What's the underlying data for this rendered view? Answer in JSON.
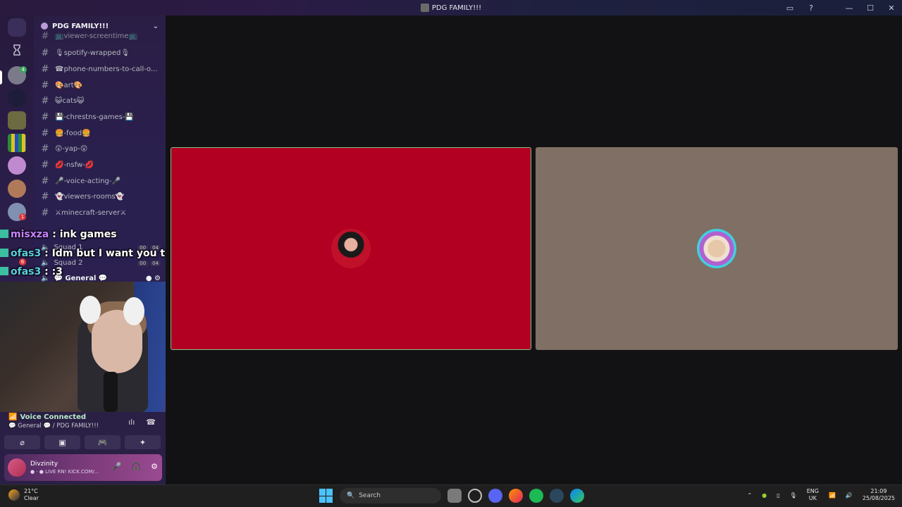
{
  "window": {
    "title": "PDG FAMILY!!!",
    "controls": {
      "inbox": "▭",
      "help": "?",
      "minimize": "—",
      "maximize": "☐",
      "close": "✕"
    }
  },
  "guild": {
    "name": "PDG FAMILY!!!",
    "chevron": "⌄"
  },
  "channels": [
    {
      "name": "📺viewer-screentime📺"
    },
    {
      "name": "🎙spotify-wrapped🎙"
    },
    {
      "name": "☎phone-numbers-to-call-o..."
    },
    {
      "name": "🎨art🎨"
    },
    {
      "name": "😺cats😺"
    },
    {
      "name": "💾-chrestns-games-💾"
    },
    {
      "name": "🍔-food🍔"
    },
    {
      "name": "😲-yap-😲"
    },
    {
      "name": "💋-nsfw-💋"
    },
    {
      "name": "🎤-voice-acting-🎤"
    },
    {
      "name": "👻viewers-rooms👻"
    },
    {
      "name": "⚔minecraft-server⚔"
    }
  ],
  "voice_channels": [
    {
      "name": "Squad 1",
      "t1": "00",
      "t2": "04"
    },
    {
      "name": "Squad 2",
      "t1": "00",
      "t2": "04"
    },
    {
      "name": "💬 General 💬"
    }
  ],
  "chat": [
    {
      "user": "misxza",
      "msg": ": ink games"
    },
    {
      "user": "ofas3",
      "msg": ": Idm but I want you to react to my vid"
    },
    {
      "user": "ofas3",
      "msg": ": :3"
    }
  ],
  "rail_badges": {
    "first": "4",
    "mid": "1",
    "low": "6"
  },
  "voice_panel": {
    "status": "Voice Connected",
    "location": "💬 General 💬 / PDG FAMILY!!!",
    "btn_video": "⌀",
    "btn_screen": "▣",
    "btn_activity": "🎮",
    "btn_sound": "✦"
  },
  "user_panel": {
    "name": "Divzinity",
    "status": "● · ● LIVE RN! KICK.COM/...",
    "mic": "🎤",
    "headset": "🎧",
    "settings": "⚙"
  },
  "taskbar": {
    "temp": "21°C",
    "condition": "Clear",
    "search_placeholder": "Search",
    "lang1": "ENG",
    "lang2": "UK",
    "time": "21:09",
    "date": "25/08/2025",
    "chevron": "⌃"
  }
}
